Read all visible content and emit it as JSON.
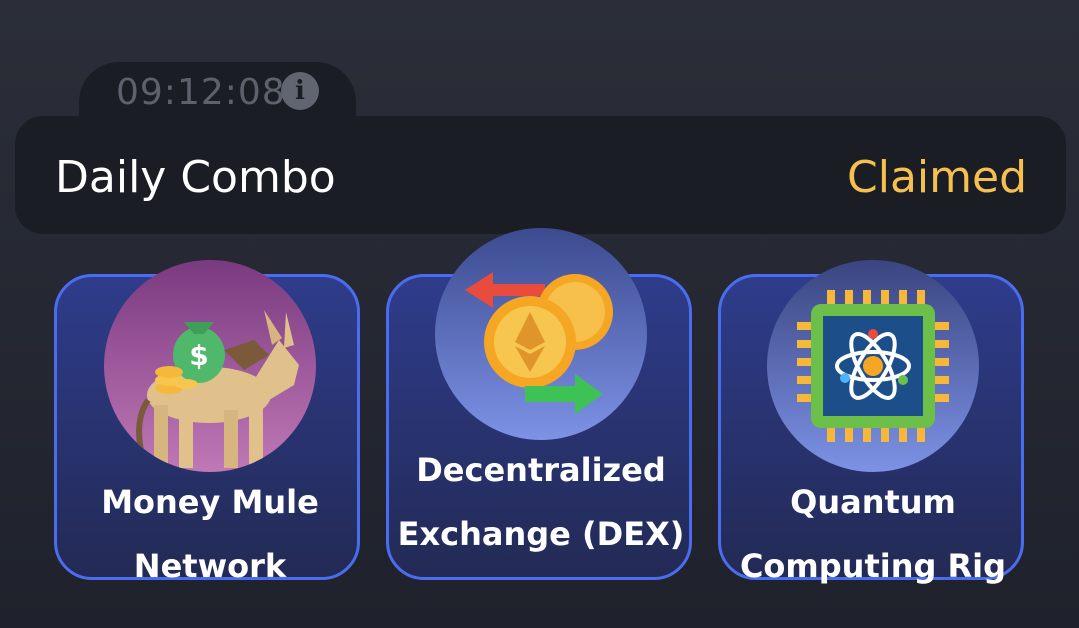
{
  "timer": {
    "value": "09:12:08",
    "info_glyph": "i"
  },
  "combo": {
    "title": "Daily Combo",
    "status": "Claimed",
    "status_color": "#f5c04d"
  },
  "cards": [
    {
      "label": "Money Mule Network",
      "icon": "money-mule-icon"
    },
    {
      "label": "Decentralized Exchange (DEX)",
      "icon": "exchange-icon"
    },
    {
      "label": "Quantum Computing Rig",
      "icon": "quantum-chip-icon"
    }
  ],
  "colors": {
    "accent_border": "#4a6df0",
    "panel": "#1b1d25"
  }
}
